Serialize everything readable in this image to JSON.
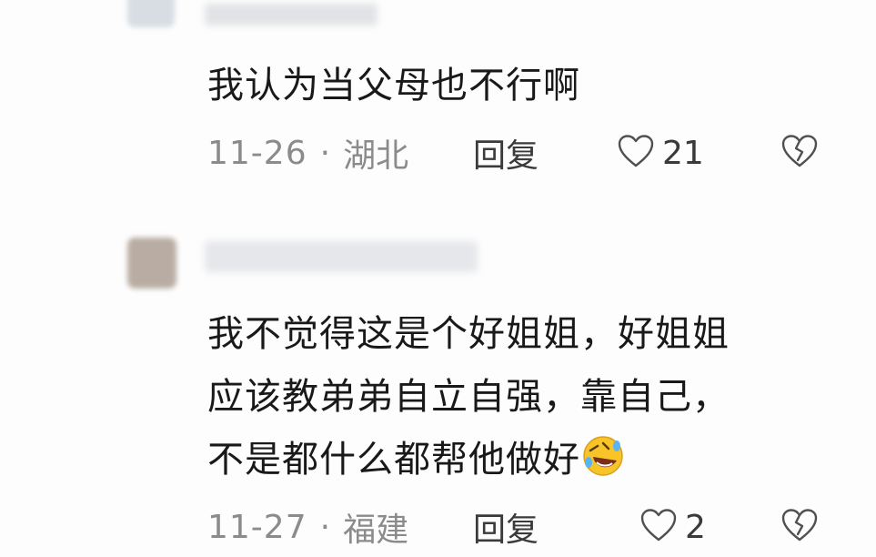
{
  "comments": [
    {
      "text": "我认为当父母也不行啊",
      "date": "11-26",
      "separator": "·",
      "location": "湖北",
      "reply_label": "回复",
      "like_count": "21"
    },
    {
      "text": "我不觉得这是个好姐姐，好姐姐\n应该教弟弟自立自强，靠自己，\n不是都什么都帮他做好",
      "emoji": "rolling-on-floor-laughing-emoji",
      "date": "11-27",
      "separator": "·",
      "location": "福建",
      "reply_label": "回复",
      "like_count": "2"
    }
  ],
  "colors": {
    "background": "#fdfdfd",
    "text": "#191919",
    "meta": "#8b8b8b",
    "icon_stroke": "#505050",
    "emoji_face": "#f7c429"
  }
}
